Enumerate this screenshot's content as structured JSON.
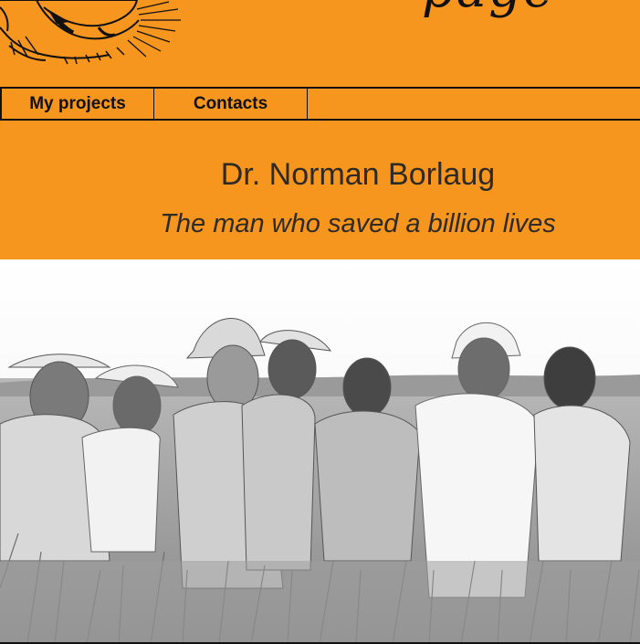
{
  "header": {
    "page_word": "page",
    "background_color": "#f7961e",
    "logo_icon": "lion-sketch-icon"
  },
  "nav": {
    "items": [
      {
        "label": "My projects"
      },
      {
        "label": "Contacts"
      }
    ]
  },
  "hero": {
    "title": "Dr. Norman Borlaug",
    "subtitle": "The man who saved a billion lives"
  },
  "photo": {
    "icon": "wheat-field-group-photo"
  }
}
